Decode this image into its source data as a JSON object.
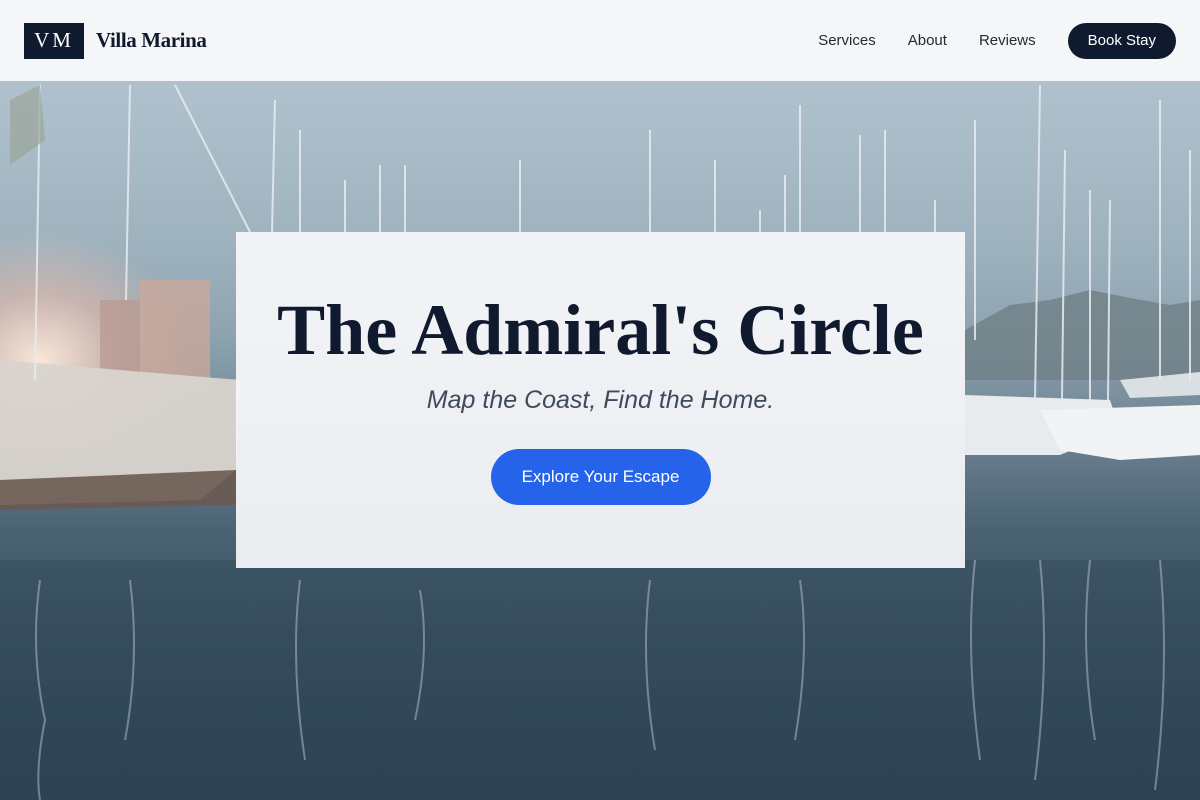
{
  "nav": {
    "logo_mark": "VM",
    "brand_name": "Villa Marina",
    "links": [
      "Services",
      "About",
      "Reviews"
    ],
    "book_label": "Book Stay"
  },
  "hero": {
    "headline": "The Admiral's Circle",
    "tagline": "Map the Coast, Find the Home.",
    "cta_label": "Explore Your Escape"
  },
  "colors": {
    "brand_navy": "#101a2e",
    "accent_blue": "#2563eb"
  },
  "icons": [
    "marina-background-image"
  ]
}
